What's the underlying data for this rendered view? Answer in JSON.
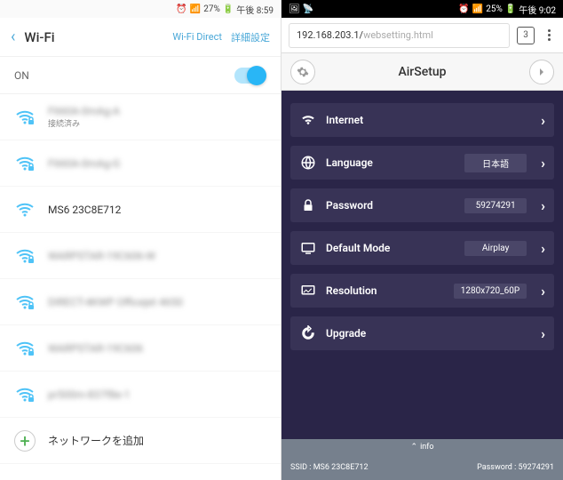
{
  "left": {
    "status": {
      "battery": "27%",
      "time": "午後 8:59"
    },
    "header": {
      "title": "Wi-Fi",
      "direct": "Wi-Fi Direct",
      "advanced": "詳細設定"
    },
    "toggle": {
      "label": "ON"
    },
    "networks": [
      {
        "name": "F660A-0mAg-A",
        "status": "接続済み",
        "blurred": true,
        "lock": true
      },
      {
        "name": "F660A-0mAg-G",
        "blurred": true,
        "lock": true
      },
      {
        "name": "MS6 23C8E712",
        "blurred": false,
        "lock": false
      },
      {
        "name": "WARPSTAR-19C606-W",
        "blurred": true,
        "lock": true
      },
      {
        "name": "DIRECT-4KWP Officejet 4650",
        "blurred": true,
        "lock": true
      },
      {
        "name": "WARPSTAR-19C606",
        "blurred": true,
        "lock": true
      },
      {
        "name": "pr500m-837f8e-1",
        "blurred": true,
        "lock": true
      }
    ],
    "add_network": "ネットワークを追加"
  },
  "right": {
    "status": {
      "battery": "25%",
      "time": "午後 9:02"
    },
    "url": {
      "host": "192.168.203.1/",
      "path": "websetting.html"
    },
    "tabs": "3",
    "app_title": "AirSetup",
    "rows": [
      {
        "icon": "wifi",
        "label": "Internet",
        "value": ""
      },
      {
        "icon": "globe",
        "label": "Language",
        "value": "日本語"
      },
      {
        "icon": "lock",
        "label": "Password",
        "value": "59274291"
      },
      {
        "icon": "display",
        "label": "Default Mode",
        "value": "Airplay"
      },
      {
        "icon": "resolution",
        "label": "Resolution",
        "value": "1280x720_60P"
      },
      {
        "icon": "upgrade",
        "label": "Upgrade",
        "value": ""
      }
    ],
    "footer": {
      "info_label": "info",
      "ssid_label": "SSID : ",
      "ssid": "MS6 23C8E712",
      "password_label": "Password : ",
      "password": "59274291"
    }
  }
}
